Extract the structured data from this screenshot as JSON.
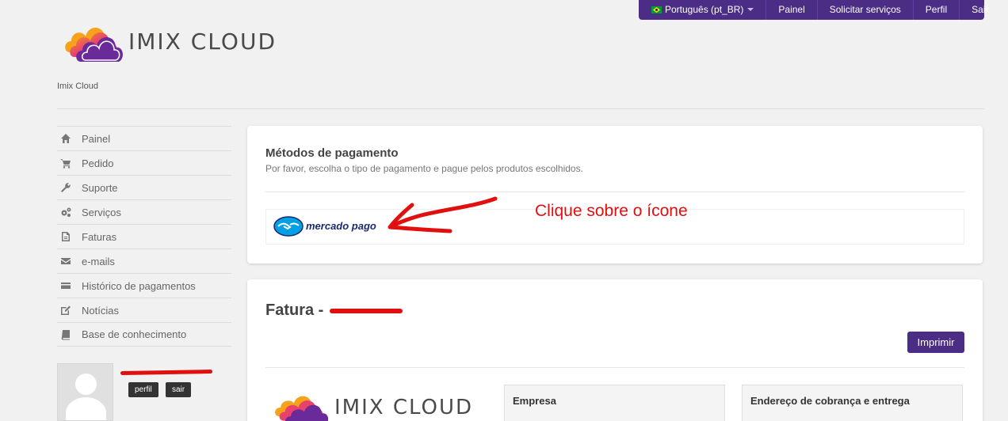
{
  "topnav": {
    "language": "Português (pt_BR)",
    "items": [
      "Painel",
      "Solicitar serviços",
      "Perfil",
      "Sair"
    ]
  },
  "brand": {
    "logo_text": "IMIX CLOUD",
    "site_name": "Imix Cloud"
  },
  "sidebar": {
    "items": [
      {
        "label": "Painel",
        "icon": "home-icon"
      },
      {
        "label": "Pedido",
        "icon": "cart-icon"
      },
      {
        "label": "Suporte",
        "icon": "wrench-icon"
      },
      {
        "label": "Serviços",
        "icon": "gears-icon"
      },
      {
        "label": "Faturas",
        "icon": "file-icon"
      },
      {
        "label": "e-mails",
        "icon": "envelope-icon"
      },
      {
        "label": "Histórico de pagamentos",
        "icon": "credit-card-icon"
      },
      {
        "label": "Notícias",
        "icon": "edit-icon"
      },
      {
        "label": "Base de conhecimento",
        "icon": "book-icon"
      }
    ]
  },
  "user": {
    "profile_btn": "perfil",
    "logout_btn": "sair"
  },
  "payment": {
    "title": "Métodos de pagamento",
    "subtitle": "Por favor, escolha o tipo de pagamento e pague pelos produtos escolhidos.",
    "method_name": "mercado pago",
    "annotation": "Clique sobre o ícone"
  },
  "invoice": {
    "title_prefix": "Fatura - ",
    "print_label": "Imprimir",
    "company_label": "Empresa",
    "billing_label": "Endereço de cobrança e entrega"
  },
  "colors": {
    "brand_purple": "#4b2d85",
    "annotation_red": "#e01010"
  }
}
